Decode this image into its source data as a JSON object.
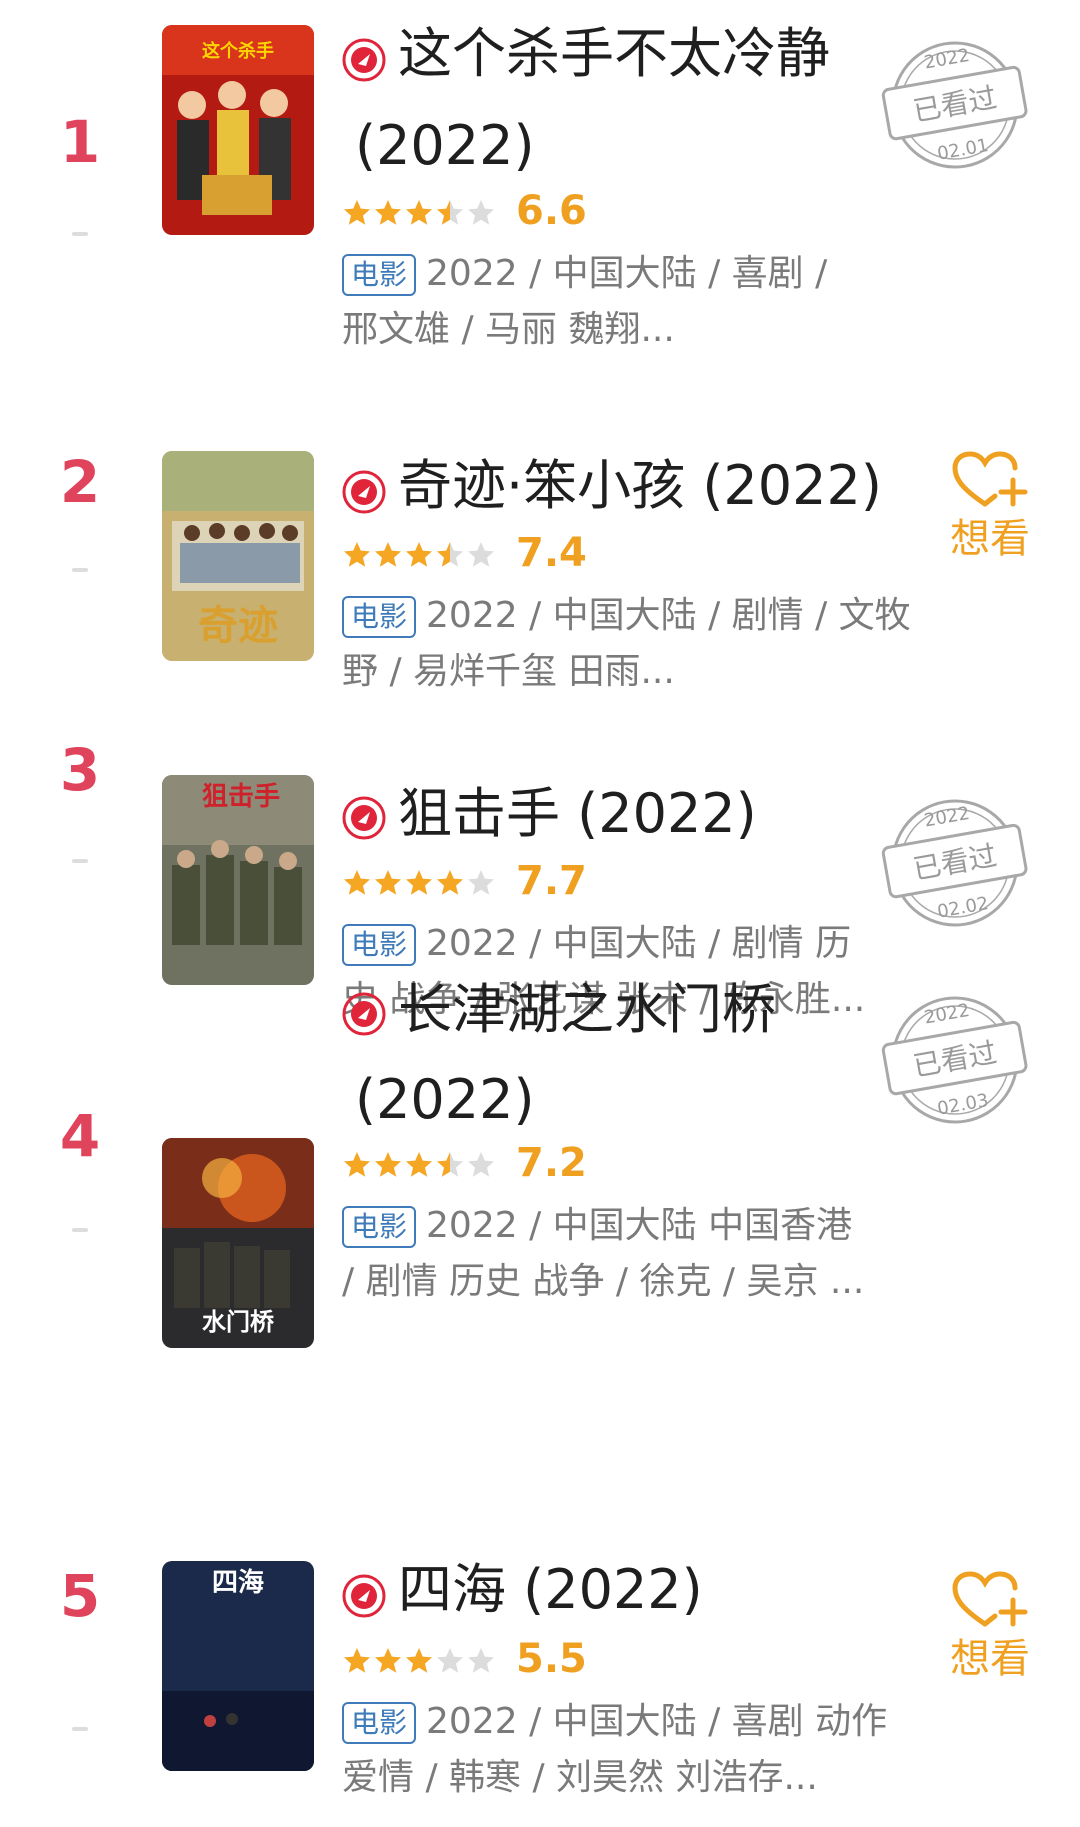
{
  "colors": {
    "rank": "#e0445c",
    "score": "#f0a020",
    "tag": "#3f7bb8",
    "meta": "#7a7a7a",
    "star_on": "#f5a623",
    "star_off": "#dcdcdc"
  },
  "movies": [
    {
      "rank": "1",
      "title": "这个杀手不太冷静",
      "year": "(2022)",
      "rating_text": "6.6",
      "rating_stars": 3.5,
      "tag": "电影",
      "meta_line1": "2022 / 中国大陆 / 喜剧 /",
      "meta_line2": "邢文雄 / 马丽 魏翔...",
      "status": "watched",
      "stamp_year": "2022",
      "stamp_text": "已看过",
      "stamp_date": "02.01",
      "poster_icon": "poster-comedy-crowd"
    },
    {
      "rank": "2",
      "title": "奇迹·笨小孩",
      "year": "(2022)",
      "rating_text": "7.4",
      "rating_stars": 3.5,
      "tag": "电影",
      "meta_line1": "2022 / 中国大陆 / 剧情 / 文牧",
      "meta_line2": "野 / 易烊千玺 田雨...",
      "status": "want",
      "want_label": "想看",
      "poster_icon": "poster-group-photo"
    },
    {
      "rank": "3",
      "title": "狙击手",
      "year": "(2022)",
      "rating_text": "7.7",
      "rating_stars": 4,
      "tag": "电影",
      "meta_line1": "2022 / 中国大陆 / 剧情 历",
      "meta_line2": "史 战争 / 张艺谋 张末 / 陈永胜...",
      "status": "watched",
      "stamp_year": "2022",
      "stamp_text": "已看过",
      "stamp_date": "02.02",
      "poster_icon": "poster-soldiers"
    },
    {
      "rank": "4",
      "title": "长津湖之水门桥",
      "year": "(2022)",
      "rating_text": "7.2",
      "rating_stars": 3.5,
      "tag": "电影",
      "meta_line1": "2022 / 中国大陆 中国香港",
      "meta_line2": "/ 剧情 历史 战争 / 徐克 / 吴京 ...",
      "status": "watched",
      "stamp_year": "2022",
      "stamp_text": "已看过",
      "stamp_date": "02.03",
      "poster_icon": "poster-war-fire"
    },
    {
      "rank": "5",
      "title": "四海",
      "year": "(2022)",
      "rating_text": "5.5",
      "rating_stars": 3,
      "tag": "电影",
      "meta_line1": "2022 / 中国大陆 / 喜剧 动作",
      "meta_line2": "爱情 / 韩寒 / 刘昊然 刘浩存...",
      "status": "want",
      "want_label": "想看",
      "poster_icon": "poster-night-sea"
    }
  ]
}
